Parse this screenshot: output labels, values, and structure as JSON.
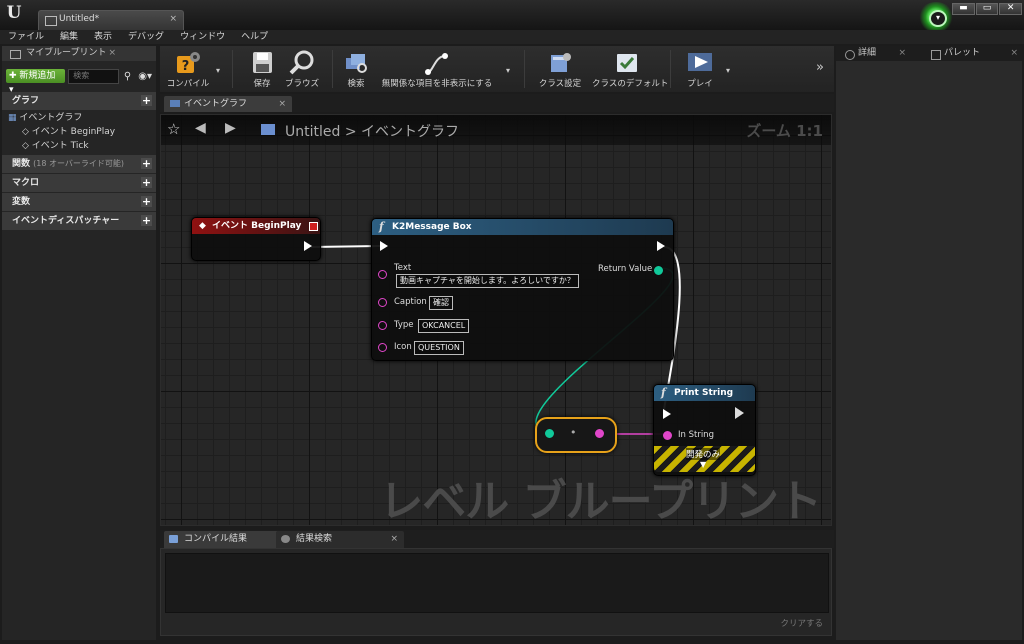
{
  "window": {
    "tab_title": "Untitled",
    "tab_modified": "*",
    "tab_close": "×",
    "app_logo": "U",
    "controls": {
      "minimize": "▬",
      "maximize": "▭",
      "close": "✕"
    }
  },
  "menu": [
    "ファイル",
    "編集",
    "表示",
    "デバッグ",
    "ウィンドウ",
    "ヘルプ"
  ],
  "my_blueprint": {
    "tab_label": "マイブループリント",
    "tab_close": "×",
    "add_new": "新規追加",
    "search_placeholder": "検索",
    "categories": {
      "graph": "グラフ",
      "functions": "関数",
      "functions_sub": "(18 オーバーライド可能)",
      "macros": "マクロ",
      "variables": "変数",
      "dispatchers": "イベントディスパッチャー"
    },
    "tree": {
      "event_graph": "イベントグラフ",
      "begin_play": "イベント BeginPlay",
      "tick": "イベント Tick"
    }
  },
  "toolbar": {
    "compile": "コンパイル",
    "save": "保存",
    "browse": "ブラウズ",
    "find": "検索",
    "hide_unrelated": "無関係な項目を非表示にする",
    "class_settings": "クラス設定",
    "class_defaults": "クラスのデフォルト",
    "play": "プレイ",
    "more": "»"
  },
  "graph_tab": {
    "label": "イベントグラフ",
    "close": "×"
  },
  "graph": {
    "breadcrumb_blueprint": "Untitled",
    "breadcrumb_sep": ">",
    "breadcrumb_graph": "イベントグラフ",
    "zoom": "ズーム 1:1",
    "watermark": "レベル ブループリント"
  },
  "nodes": {
    "begin_play": {
      "title": "イベント BeginPlay"
    },
    "message_box": {
      "title": "K2Message Box",
      "pins": [
        {
          "label": "Text",
          "value": "動画キャプチャを開始します。よろしいですか？"
        },
        {
          "label": "Caption",
          "value": "確認"
        },
        {
          "label": "Type",
          "value": "OKCANCEL"
        },
        {
          "label": "Icon",
          "value": "QUESTION"
        }
      ],
      "return_label": "Return Value"
    },
    "print_string": {
      "title": "Print String",
      "in_string": "In String",
      "dev_only": "開発のみ"
    },
    "convert": {
      "label": "•"
    }
  },
  "bottom": {
    "tab_compile": "コンパイル結果",
    "tab_find": "結果検索",
    "tab_close": "×",
    "clear": "クリアする"
  },
  "right_panel": {
    "details": "詳細",
    "palette": "パレット",
    "close": "×"
  },
  "colors": {
    "event_node": "#8f1111",
    "function_node": "#2d5f82",
    "exec_wire": "#ffffff",
    "string_pin": "#e046c9",
    "byte_pin": "#11c99a",
    "add_button": "#5ca22e"
  }
}
